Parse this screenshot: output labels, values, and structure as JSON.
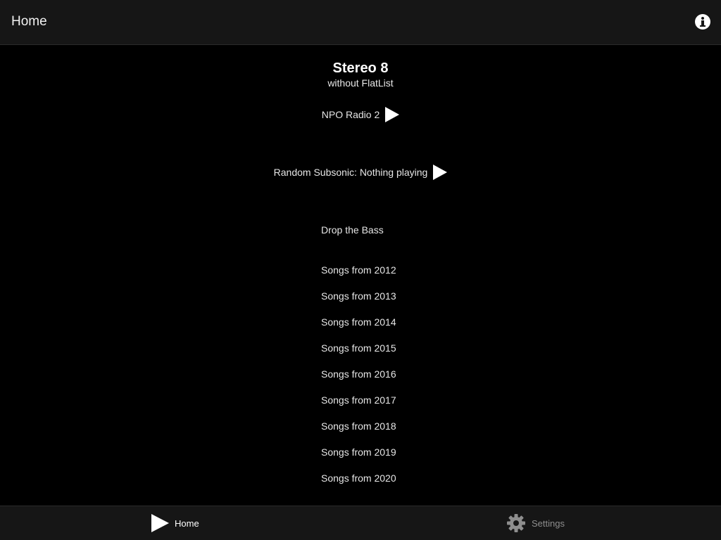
{
  "header": {
    "title": "Home",
    "info_icon": "info-icon"
  },
  "app": {
    "title": "Stereo 8",
    "subtitle": "without FlatList"
  },
  "streams": [
    {
      "label": "NPO Radio 2",
      "icon": "play-icon"
    },
    {
      "label": "Random Subsonic: Nothing playing",
      "icon": "play-icon"
    }
  ],
  "playlists": [
    "Drop the Bass",
    "Songs from 2012",
    "Songs from 2013",
    "Songs from 2014",
    "Songs from 2015",
    "Songs from 2016",
    "Songs from 2017",
    "Songs from 2018",
    "Songs from 2019",
    "Songs from 2020"
  ],
  "tabbar": {
    "home": {
      "label": "Home",
      "icon": "play-icon",
      "active": true
    },
    "settings": {
      "label": "Settings",
      "icon": "gear-icon",
      "active": false
    }
  },
  "colors": {
    "background": "#000000",
    "bar": "#161616",
    "inactive_tab": "#8e8e8e"
  }
}
